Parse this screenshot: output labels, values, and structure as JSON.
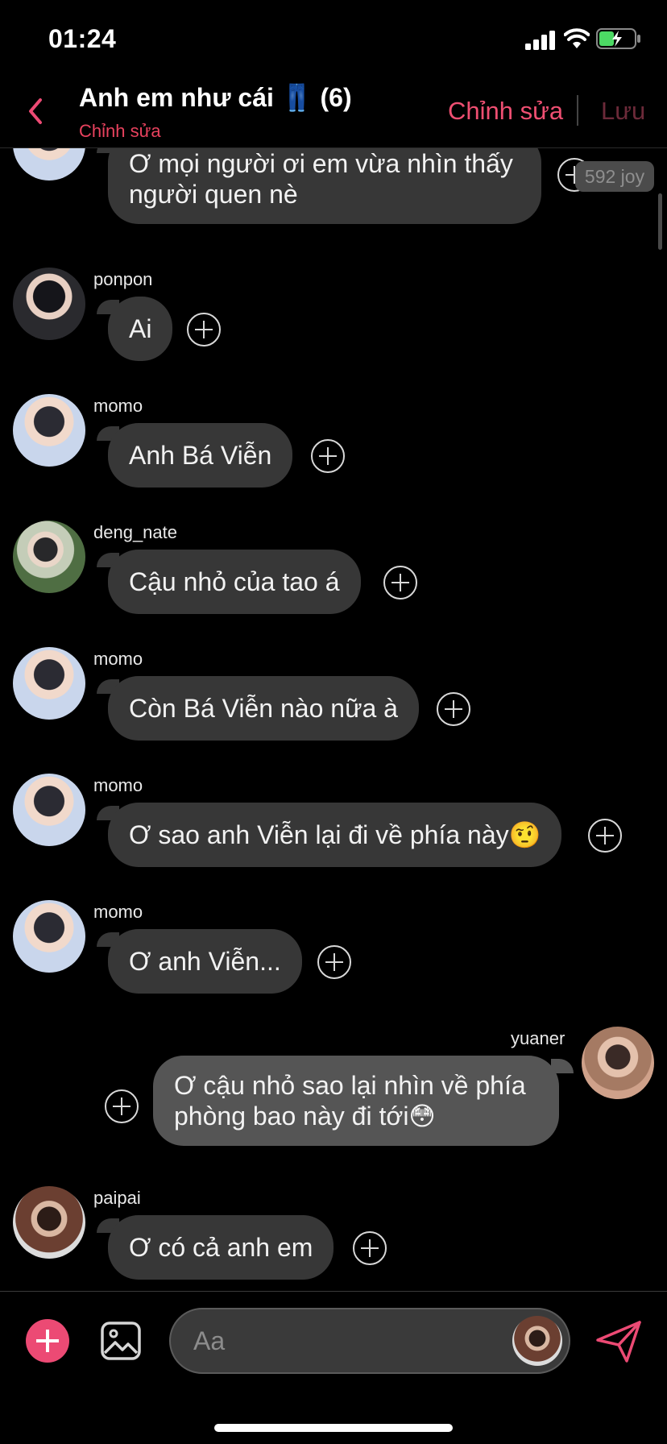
{
  "status_bar": {
    "time": "01:24"
  },
  "header": {
    "title": "Anh em như cái 👖 (6)",
    "subtitle": "Chỉnh sửa",
    "edit_label": "Chỉnh sửa",
    "save_label": "Lưu"
  },
  "joy_badge": "592 joy",
  "messages": [
    {
      "sender": "",
      "text_lines": [
        "Ơ mọi người ơi em vừa nhìn thấy",
        "người quen nè"
      ],
      "side": "left"
    },
    {
      "sender": "ponpon",
      "text_lines": [
        "Ai"
      ],
      "side": "left"
    },
    {
      "sender": "momo",
      "text_lines": [
        "Anh Bá Viễn"
      ],
      "side": "left"
    },
    {
      "sender": "deng_nate",
      "text_lines": [
        "Cậu nhỏ của tao á"
      ],
      "side": "left"
    },
    {
      "sender": "momo",
      "text_lines": [
        "Còn Bá Viễn nào nữa à"
      ],
      "side": "left"
    },
    {
      "sender": "momo",
      "text_lines": [
        "Ơ sao anh Viễn lại đi về phía này🤨"
      ],
      "side": "left"
    },
    {
      "sender": "momo",
      "text_lines": [
        "Ơ anh Viễn..."
      ],
      "side": "left"
    },
    {
      "sender": "yuaner",
      "text_lines": [
        "Ơ cậu nhỏ sao lại nhìn về phía",
        "phòng bao này đi tới😳"
      ],
      "side": "right"
    },
    {
      "sender": "paipai",
      "text_lines": [
        "Ơ có cả anh em"
      ],
      "side": "left"
    }
  ],
  "composer": {
    "placeholder": "Aa"
  },
  "icons": {
    "back": "chevron-left-icon",
    "add": "plus-circle-icon",
    "image": "image-icon",
    "send": "send-icon"
  },
  "colors": {
    "accent": "#ec4a74",
    "bubble": "#373737",
    "background": "#000000"
  }
}
